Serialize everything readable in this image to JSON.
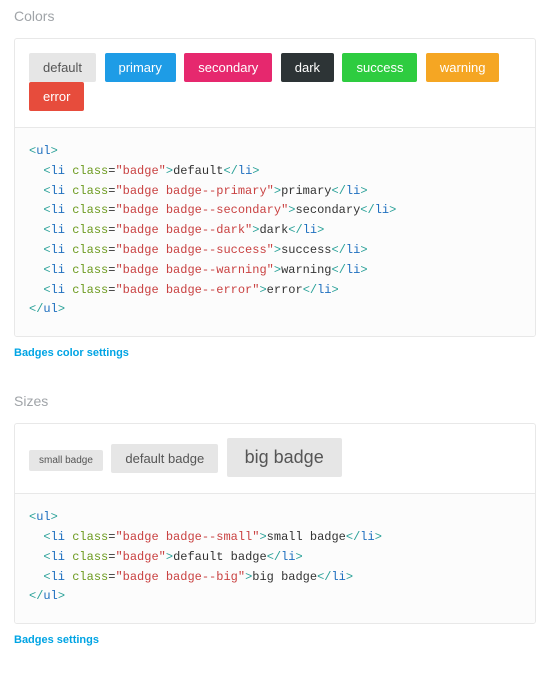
{
  "colors_section": {
    "title": "Colors",
    "badges": [
      {
        "label": "default",
        "class": "badge"
      },
      {
        "label": "primary",
        "class": "badge badge--primary"
      },
      {
        "label": "secondary",
        "class": "badge badge--secondary"
      },
      {
        "label": "dark",
        "class": "badge badge--dark"
      },
      {
        "label": "success",
        "class": "badge badge--success"
      },
      {
        "label": "warning",
        "class": "badge badge--warning"
      },
      {
        "label": "error",
        "class": "badge badge--error"
      }
    ],
    "code_items": [
      {
        "class_attr": "badge",
        "text": "default"
      },
      {
        "class_attr": "badge badge--primary",
        "text": "primary"
      },
      {
        "class_attr": "badge badge--secondary",
        "text": "secondary"
      },
      {
        "class_attr": "badge badge--dark",
        "text": "dark"
      },
      {
        "class_attr": "badge badge--success",
        "text": "success"
      },
      {
        "class_attr": "badge badge--warning",
        "text": "warning"
      },
      {
        "class_attr": "badge badge--error",
        "text": "error"
      }
    ],
    "link": "Badges color settings"
  },
  "sizes_section": {
    "title": "Sizes",
    "badges": [
      {
        "label": "small badge",
        "class": "badge badge--small"
      },
      {
        "label": "default badge",
        "class": "badge"
      },
      {
        "label": "big badge",
        "class": "badge badge--big"
      }
    ],
    "code_items": [
      {
        "class_attr": "badge badge--small",
        "text": "small badge"
      },
      {
        "class_attr": "badge",
        "text": "default badge"
      },
      {
        "class_attr": "badge badge--big",
        "text": "big badge"
      }
    ],
    "link": "Badges settings"
  }
}
